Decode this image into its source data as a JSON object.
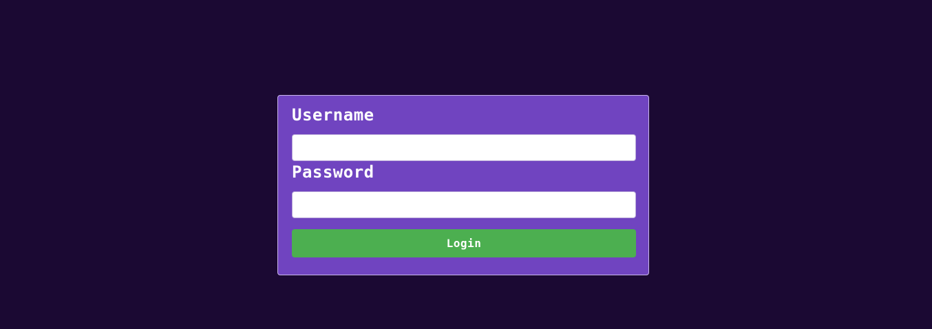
{
  "login_form": {
    "username_label": "Username",
    "username_value": "",
    "password_label": "Password",
    "password_value": "",
    "submit_label": "Login"
  },
  "colors": {
    "page_background": "#1b0933",
    "card_background": "#7044c0",
    "button_background": "#4caf50",
    "text": "#ffffff"
  }
}
